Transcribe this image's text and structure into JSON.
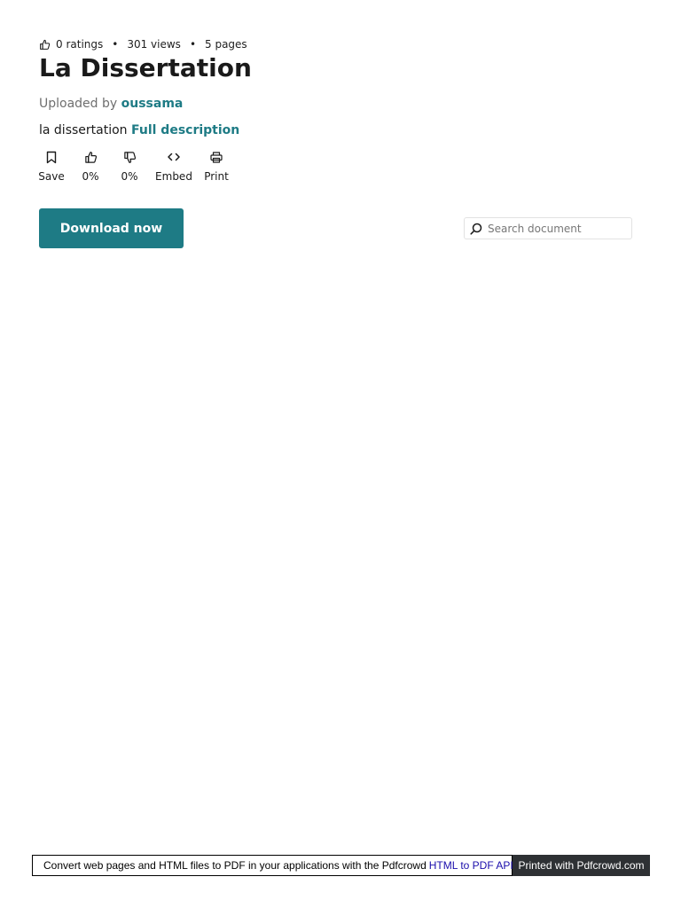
{
  "stats": {
    "ratings": "0 ratings",
    "views": "301 views",
    "pages": "5 pages",
    "separator": "•"
  },
  "title": "La Dissertation",
  "uploaded": {
    "prefix": "Uploaded by",
    "user": "oussama"
  },
  "description": {
    "text": "la dissertation",
    "link": "Full description"
  },
  "actions": {
    "save": "Save",
    "like": "0%",
    "dislike": "0%",
    "embed": "Embed",
    "print": "Print"
  },
  "download_button": "Download now",
  "search": {
    "placeholder": "Search document",
    "value": ""
  },
  "footer": {
    "text": "Convert web pages and HTML files to PDF in your applications with the Pdfcrowd",
    "link": "HTML to PDF API",
    "badge": "Printed with Pdfcrowd.com"
  },
  "colors": {
    "accent": "#1e7b85",
    "footer_badge_bg": "#2e3134",
    "link_blue": "#1a0dab"
  },
  "icons": [
    "thumbs-up-icon",
    "bookmark-icon",
    "thumbs-up-icon",
    "thumbs-down-icon",
    "code-icon",
    "printer-icon",
    "search-icon"
  ]
}
